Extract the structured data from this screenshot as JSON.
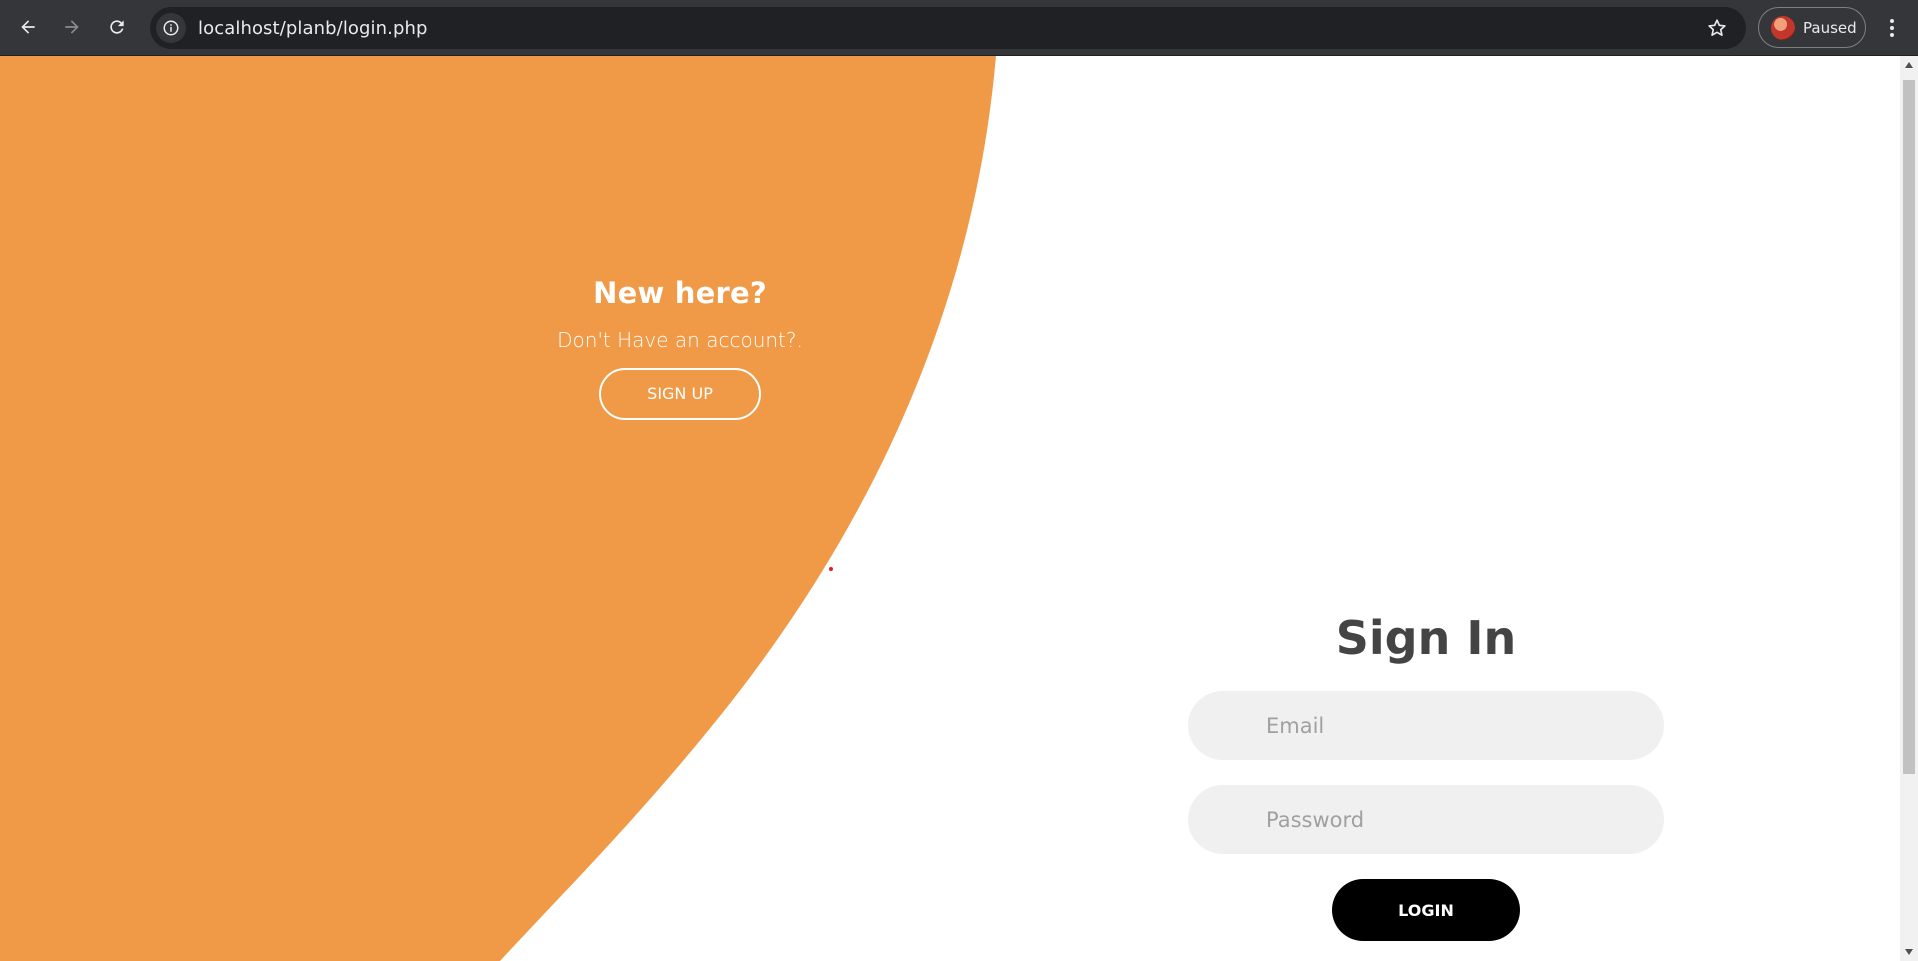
{
  "browser": {
    "url": "localhost/planb/login.php",
    "profile_status": "Paused",
    "icons": {
      "back": "back-arrow-icon",
      "forward": "forward-arrow-icon",
      "reload": "reload-icon",
      "site_info": "info-icon",
      "bookmark": "star-icon",
      "menu": "kebab-menu-icon"
    }
  },
  "colors": {
    "accent_orange": "#f09a48",
    "chrome_dark": "#35363a",
    "input_bg": "#f0f0f0",
    "button_black": "#000000"
  },
  "left_panel": {
    "title": "New here?",
    "subtitle": "Don't Have an account?.",
    "signup_label": "SIGN UP"
  },
  "signin": {
    "title": "Sign In",
    "email_placeholder": "Email",
    "password_placeholder": "Password",
    "login_label": "LOGIN"
  }
}
